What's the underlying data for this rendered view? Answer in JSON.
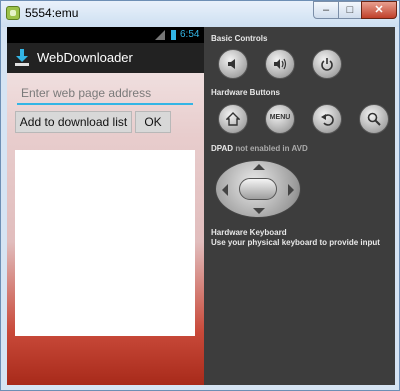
{
  "window": {
    "title": "5554:emu",
    "minimize_label": "–",
    "maximize_label": "□",
    "close_label": "✕"
  },
  "status_bar": {
    "time": "6:54"
  },
  "app": {
    "title": "WebDownloader",
    "url_placeholder": "Enter web page address",
    "url_value": "",
    "add_button_label": "Add to download list",
    "ok_button_label": "OK"
  },
  "controls": {
    "basic_controls_title": "Basic Controls",
    "hardware_buttons_title": "Hardware Buttons",
    "menu_label": "MENU",
    "dpad_title": "DPAD",
    "dpad_note": "not enabled in AVD",
    "keyboard_title": "Hardware Keyboard",
    "keyboard_note": "Use your physical keyboard to provide input"
  },
  "icons": [
    "volume-down-icon",
    "volume-up-icon",
    "power-icon",
    "home-icon",
    "back-icon",
    "search-icon",
    "download-icon"
  ],
  "colors": {
    "accent": "#33b5e5",
    "panel": "#3d3d3d",
    "close_red": "#c0402a"
  }
}
